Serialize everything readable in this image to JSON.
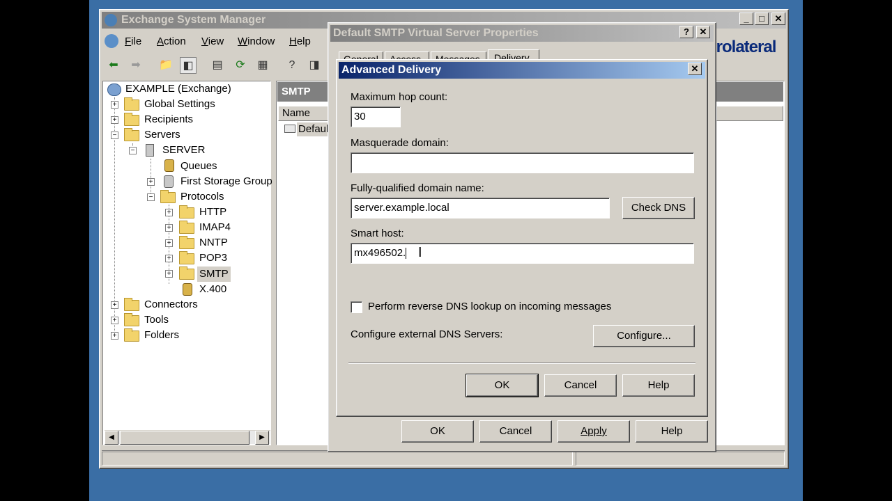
{
  "esm": {
    "title": "Exchange System Manager",
    "menu": [
      "File",
      "Action",
      "View",
      "Window",
      "Help"
    ],
    "tree": {
      "root": "EXAMPLE (Exchange)",
      "global_settings": "Global Settings",
      "recipients": "Recipients",
      "servers": "Servers",
      "server": "SERVER",
      "queues": "Queues",
      "first_storage_group": "First Storage Group",
      "protocols": "Protocols",
      "http": "HTTP",
      "imap4": "IMAP4",
      "nntp": "NNTP",
      "pop3": "POP3",
      "smtp": "SMTP",
      "x400": "X.400",
      "connectors": "Connectors",
      "tools": "Tools",
      "folders": "Folders"
    },
    "right_header": "SMTP",
    "col_name": "Name",
    "list_item": "Defaul"
  },
  "props": {
    "title": "Default SMTP Virtual Server Properties",
    "tabs": [
      "General",
      "Access",
      "Messages",
      "Delivery"
    ],
    "ok": "OK",
    "cancel": "Cancel",
    "apply": "Apply",
    "help": "Help"
  },
  "adv": {
    "title": "Advanced Delivery",
    "max_hop_label": "Maximum hop count:",
    "max_hop_value": "30",
    "masquerade_label": "Masquerade domain:",
    "masquerade_value": "",
    "fqdn_label": "Fully-qualified domain name:",
    "fqdn_value": "server.example.local",
    "check_dns": "Check DNS",
    "smart_host_label": "Smart host:",
    "smart_host_value": "mx496502.",
    "reverse_dns_label": "Perform reverse DNS lookup on incoming messages",
    "reverse_dns_checked": false,
    "ext_dns_label": "Configure external DNS Servers:",
    "configure": "Configure...",
    "ok": "OK",
    "cancel": "Cancel",
    "help": "Help"
  },
  "watermark": "prolateral"
}
